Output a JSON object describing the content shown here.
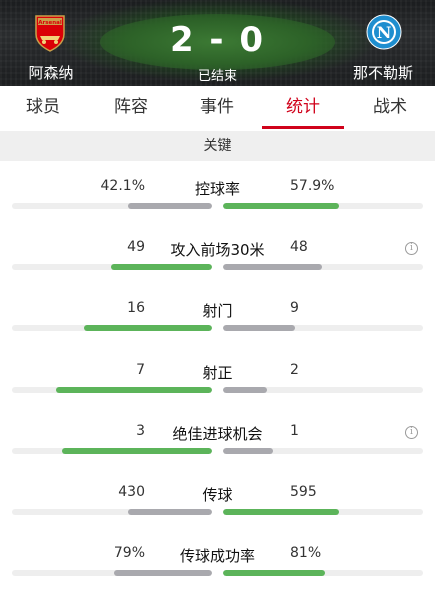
{
  "match": {
    "home_team": "阿森纳",
    "away_team": "那不勒斯",
    "score": "2 - 0",
    "status": "已结束",
    "home_crest_text": "Arsenal",
    "away_crest_text": "N"
  },
  "colors": {
    "accent": "#d0021b",
    "bar_lead": "#5cb45a",
    "bar_trail": "#a9a9ae",
    "bar_track": "#eeeeee"
  },
  "tabs": [
    {
      "label": "球员"
    },
    {
      "label": "阵容"
    },
    {
      "label": "事件"
    },
    {
      "label": "统计",
      "active": true
    },
    {
      "label": "战术"
    }
  ],
  "section": {
    "title": "关键"
  },
  "stats": [
    {
      "label": "控球率",
      "home": "42.1%",
      "away": "57.9%",
      "home_share": 0.421,
      "away_share": 0.579,
      "info": false
    },
    {
      "label": "攻入前场30米",
      "home": "49",
      "away": "48",
      "home_share": 0.505,
      "away_share": 0.495,
      "info": true
    },
    {
      "label": "射门",
      "home": "16",
      "away": "9",
      "home_share": 0.64,
      "away_share": 0.36,
      "info": false
    },
    {
      "label": "射正",
      "home": "7",
      "away": "2",
      "home_share": 0.78,
      "away_share": 0.22,
      "info": false
    },
    {
      "label": "绝佳进球机会",
      "home": "3",
      "away": "1",
      "home_share": 0.75,
      "away_share": 0.25,
      "info": true
    },
    {
      "label": "传球",
      "home": "430",
      "away": "595",
      "home_share": 0.42,
      "away_share": 0.58,
      "info": false
    },
    {
      "label": "传球成功率",
      "home": "79%",
      "away": "81%",
      "home_share": 0.49,
      "away_share": 0.51,
      "info": false
    }
  ],
  "icons": {
    "info": "info-icon"
  }
}
